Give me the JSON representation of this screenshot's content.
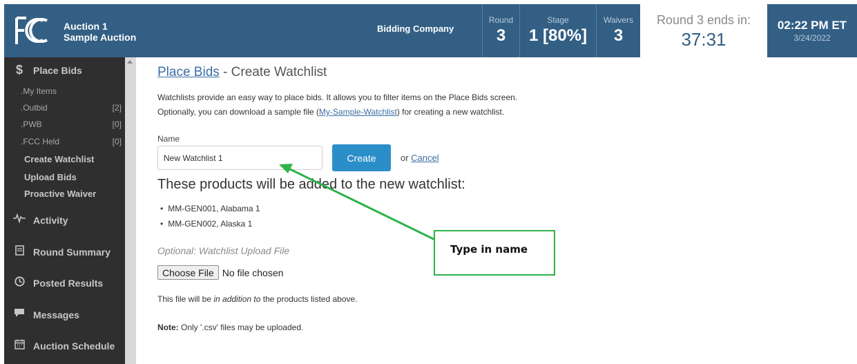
{
  "header": {
    "auction_line1": "Auction 1",
    "auction_line2": "Sample Auction",
    "bidder": "Bidding Company",
    "round_label": "Round",
    "round_value": "3",
    "stage_label": "Stage",
    "stage_value": "1 [80%]",
    "waivers_label": "Waivers",
    "waivers_value": "3",
    "ends_label": "Round 3 ends in:",
    "ends_value": "37:31",
    "time": "02:22 PM ET",
    "date": "3/24/2022",
    "logo_text": "FCC"
  },
  "sidebar": {
    "place_bids": "Place Bids",
    "sub_items": [
      {
        "label": ".My Items",
        "count": ""
      },
      {
        "label": ".Outbid",
        "count": "[2]"
      },
      {
        "label": ".PWB",
        "count": "[0]"
      },
      {
        "label": ".FCC Held",
        "count": "[0]"
      }
    ],
    "items": [
      "Create Watchlist",
      "Upload Bids",
      "Proactive Waiver"
    ],
    "sections": [
      "Activity",
      "Round Summary",
      "Posted Results",
      "Messages",
      "Auction Schedule"
    ]
  },
  "main": {
    "title_link": "Place Bids",
    "title_rest": " - Create Watchlist",
    "desc_line1": "Watchlists provide an easy way to place bids. It allows you to filter items on the Place Bids screen.",
    "desc_line2_a": "Optionally, you can download a sample file (",
    "desc_line2_link": "My-Sample-Watchlist",
    "desc_line2_b": ") for creating a new watchlist.",
    "name_label": "Name",
    "name_value": "New Watchlist 1",
    "create_label": "Create",
    "or_text": "or ",
    "cancel_label": "Cancel",
    "products_heading": "These products will be added to the new watchlist:",
    "products": [
      "MM-GEN001, Alabama 1",
      "MM-GEN002, Alaska 1"
    ],
    "optional_label": "Optional: Watchlist Upload File",
    "choose_file_label": "Choose File",
    "no_file_text": "No file chosen",
    "addition_a": "This file will be ",
    "addition_em": "in addition to",
    "addition_b": " the products listed above.",
    "note_label": "Note:",
    "note_text": " Only '.csv' files may be uploaded."
  },
  "annotation": {
    "callout_text": "Type in name",
    "color": "#2db34a"
  },
  "colors": {
    "header_blue": "#335f85",
    "sidebar_dark": "#2f2f2f",
    "button_blue": "#2b8ec9",
    "link_blue": "#3b6ea5"
  }
}
